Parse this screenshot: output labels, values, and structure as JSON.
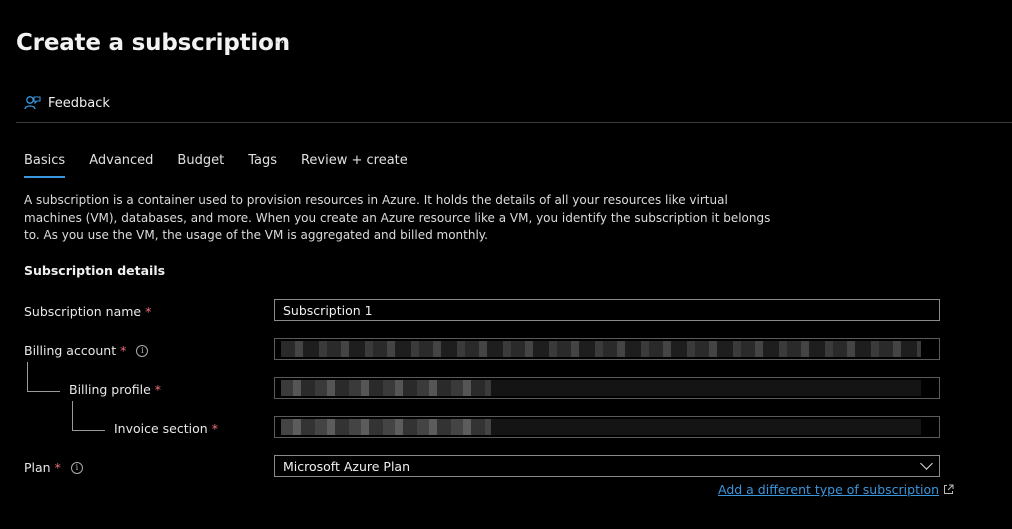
{
  "page": {
    "title": "Create a subscription",
    "more_label": "···"
  },
  "toolbar": {
    "feedback_label": "Feedback"
  },
  "tabs": [
    {
      "label": "Basics",
      "active": true
    },
    {
      "label": "Advanced"
    },
    {
      "label": "Budget"
    },
    {
      "label": "Tags"
    },
    {
      "label": "Review + create"
    }
  ],
  "description": "A subscription is a container used to provision resources in Azure. It holds the details of all your resources like virtual machines (VM), databases, and more. When you create an Azure resource like a VM, you identify the subscription it belongs to. As you use the VM, the usage of the VM is aggregated and billed monthly.",
  "form": {
    "section_title": "Subscription details",
    "subscription_name": {
      "label": "Subscription name",
      "value": "Subscription 1"
    },
    "billing_account": {
      "label": "Billing account"
    },
    "billing_profile": {
      "label": "Billing profile"
    },
    "invoice_section": {
      "label": "Invoice section"
    },
    "plan": {
      "label": "Plan",
      "value": "Microsoft Azure Plan"
    },
    "required_marker": "*",
    "add_link": "Add a different type of subscription"
  },
  "colors": {
    "accent": "#3a96dd",
    "required": "#f1707b",
    "background": "#000000"
  }
}
